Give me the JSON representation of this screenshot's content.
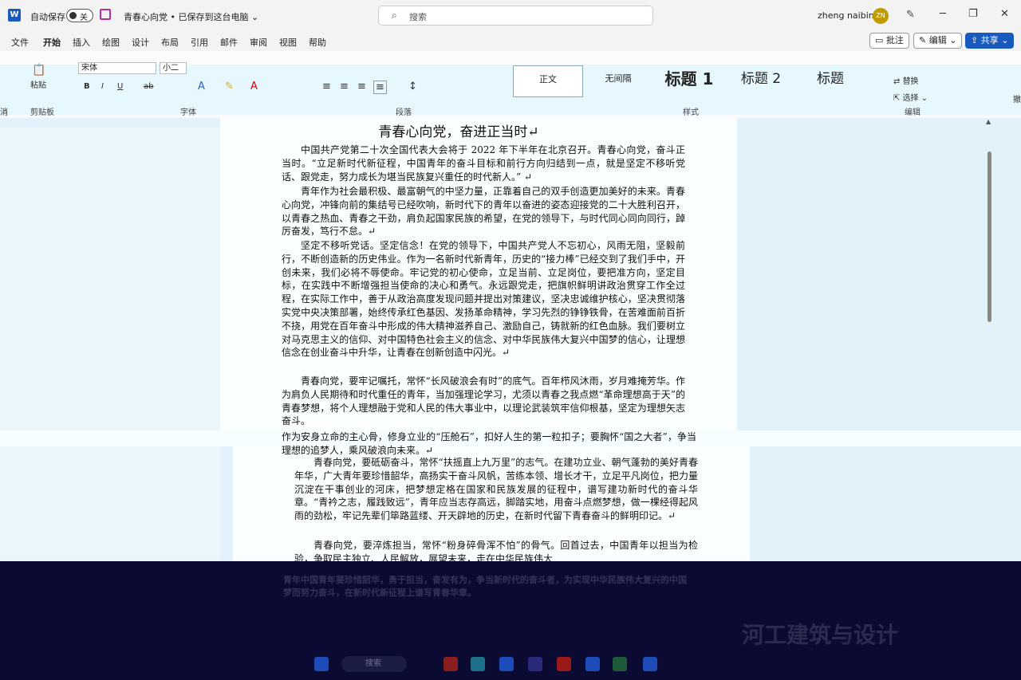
{
  "titlebar": {
    "autosave_label": "自动保存",
    "autosave_state": "关",
    "doc_title": "青春心向党 • 已保存到这台电脑 ⌄",
    "search_placeholder": "搜索",
    "user_name": "zheng naibin",
    "avatar_initials": "ZN"
  },
  "menu": {
    "tabs": [
      "文件",
      "开始",
      "插入",
      "绘图",
      "设计",
      "布局",
      "引用",
      "邮件",
      "审阅",
      "视图",
      "帮助"
    ],
    "comment": "批注",
    "edit": "编辑 ⌄",
    "share": "共享 ⌄"
  },
  "ribbon": {
    "paste": "粘贴",
    "font_name": "宋体",
    "font_size": "小二",
    "groups": [
      "剪贴板",
      "字体",
      "段落",
      "样式",
      "编辑"
    ],
    "styles": [
      "正文",
      "无间隔",
      "标题 1",
      "标题 2",
      "标题"
    ],
    "replace": "替换",
    "select": "选择 ⌄",
    "left_cut": "消",
    "right_cut": "撤"
  },
  "document": {
    "heading": "青春心向党，奋进正当时↵",
    "paragraphs": [
      "中国共产党第二十次全国代表大会将于 2022 年下半年在北京召开。青春心向党，奋斗正当时。“立足新时代新征程，中国青年的奋斗目标和前行方向归结到一点，就是坚定不移听党话、跟党走，努力成长为堪当民族复兴重任的时代新人。” ↵",
      "青年作为社会最积极、最富朝气的中坚力量，正靠着自己的双手创造更加美好的未来。青春心向党，冲锋向前的集结号已经吹响，新时代下的青年以奋进的姿态迎接党的二十大胜利召开，以青春之热血、青春之干劲，肩负起国家民族的希望，在党的领导下，与时代同心同向同行，踔厉奋发，笃行不怠。↵",
      "坚定不移听党话。坚定信念！在党的领导下，中国共产党人不忘初心，风雨无阻，坚毅前行，不断创造新的历史伟业。作为一名新时代新青年，历史的“接力棒”已经交到了我们手中，开创未来，我们必将不辱使命。牢记党的初心使命，立足当前、立足岗位，要把准方向，坚定目标，在实践中不断增强担当使命的决心和勇气。永远跟党走，把旗帜鲜明讲政治贯穿工作全过程，在实际工作中，善于从政治高度发现问题并提出对策建议，坚决忠诚维护核心，坚决贯彻落实党中央决策部署，始终传承红色基因、发扬革命精神，学习先烈的铮铮铁骨，在苦难面前百折不挠，用党在百年奋斗中形成的伟大精神滋养自己、激励自己，铸就新的红色血脉。我们要树立对马克思主义的信仰、对中国特色社会主义的信念、对中华民族伟大复兴中国梦的信心，让理想信念在创业奋斗中升华，让青春在创新创造中闪光。↵",
      "青春向党，要牢记嘱托，常怀“长风破浪会有时”的底气。百年栉风沐雨，岁月难掩芳华。作为肩负人民期待和时代重任的青年，当加强理论学习，尤须以青春之我点燃“革命理想高于天”的青春梦想，将个人理想融于党和人民的伟大事业中，以理论武装筑牢信仰根基，坚定为理想矢志奋斗。",
      "青春向党，要砥砺奋斗，常怀“扶摇直上九万里”的志气。在建功立业、朝气蓬勃的美好青春年华，广大青年要珍惜韶华，高扬实干奋斗风帆，苦练本领、增长才干，立足平凡岗位，把力量沉淀在干事创业的河床，把梦想定格在国家和民族发展的征程中，谱写建功新时代的奋斗华章。“青衿之志，履践致远”，青年应当志存高远，脚踏实地，用奋斗点燃梦想，做一棵经得起风雨的劲松，牢记先辈们筚路蓝缕、开天辟地的历史，在新时代留下青春奋斗的鲜明印记。↵",
      "青春向党，要淬炼担当，常怀“粉身碎骨浑不怕”的骨气。回首过去，中国青年以担当为检验，争取民主独立、人民解放，展望未来，走在中华民族伟大"
    ],
    "glitch_line": "作为安身立命的主心骨，修身立业的“压舱石”，扣好人生的第一粒扣子；要胸怀“国之大者”，争当理想的追梦人，乘风破浪向未来。↵"
  },
  "overlay": {
    "dark_text": "青年中国青年要珍惜韶华，勇于担当，奋发有为，争当新时代的奋斗者，为实现中华民族伟大复兴的中国梦而努力奋斗，在新时代新征程上谱写青春华章。",
    "watermark": "河工建筑与设计",
    "taskbar_search": "搜索"
  }
}
